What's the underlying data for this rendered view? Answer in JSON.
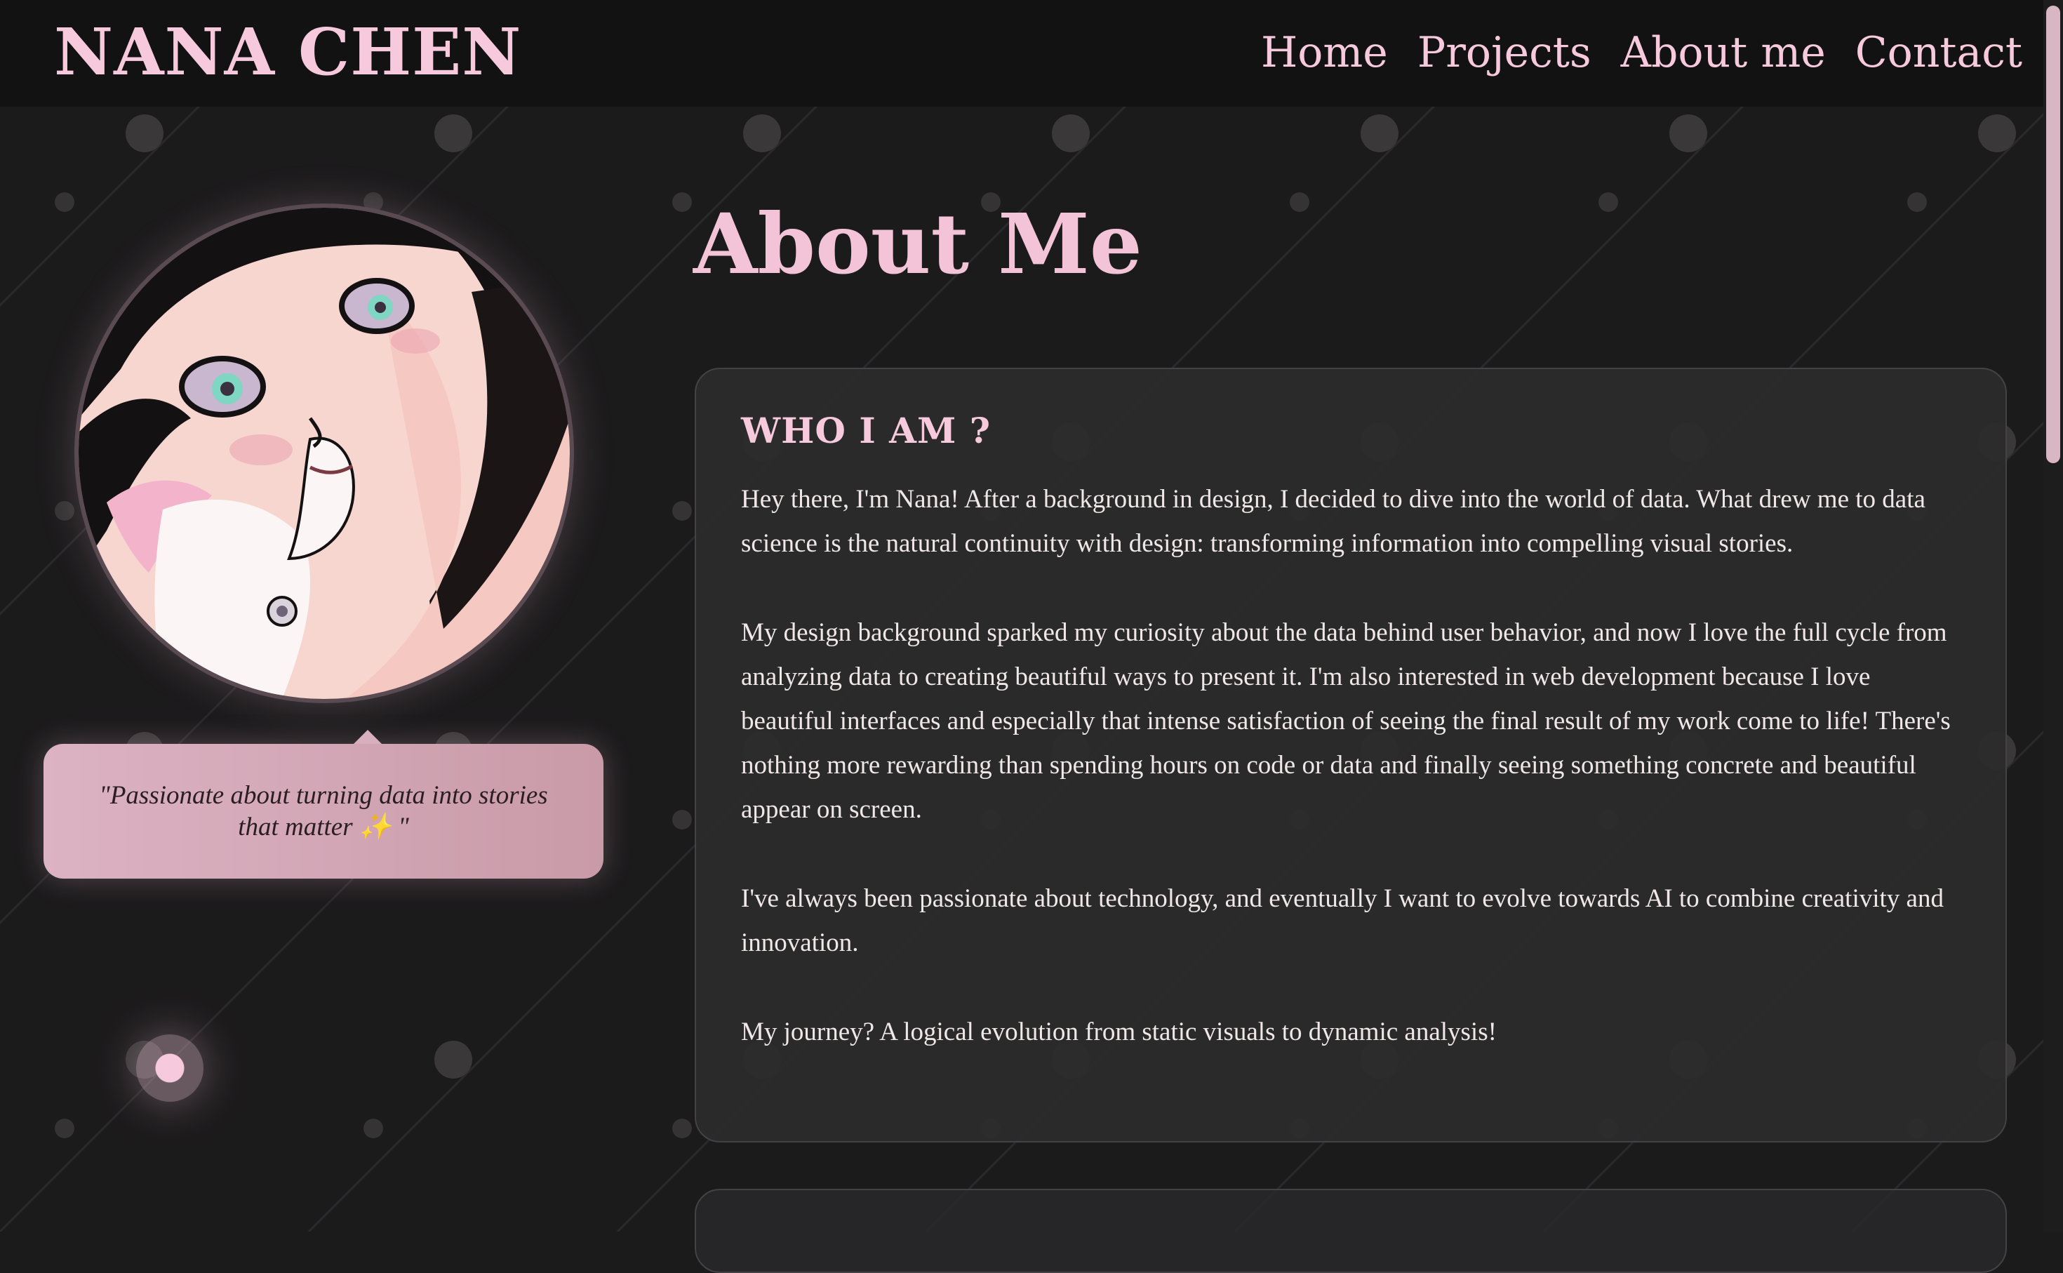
{
  "header": {
    "brand": "NANA CHEN",
    "nav": [
      "Home",
      "Projects",
      "About me",
      "Contact"
    ]
  },
  "profile": {
    "quote": "\"Passionate about turning data into stories that matter",
    "quote_end": "\"",
    "sparkle": "✨"
  },
  "main": {
    "title": "About Me",
    "card": {
      "heading": "WHO I AM ?",
      "paragraphs": [
        "Hey there, I'm Nana! After a background in design, I decided to dive into the world of data. What drew me to data science is the natural continuity with design: transforming information into compelling visual stories.",
        "My design background sparked my curiosity about the data behind user behavior, and now I love the full cycle from analyzing data to creating beautiful ways to present it. I'm also interested in web development because I love beautiful interfaces and especially that intense satisfaction of seeing the final result of my work come to life! There's nothing more rewarding than spending hours on code or data and finally seeing something concrete and beautiful appear on screen.",
        "I've always been passionate about technology, and eventually I want to evolve towards AI to combine creativity and innovation.",
        "My journey? A logical evolution from static visuals to dynamic analysis!"
      ]
    }
  },
  "colors": {
    "background": "#1c1b1c",
    "header": "#131213",
    "accent_pink": "#f6c9dc",
    "card": "#2c2b2d"
  },
  "icons": {
    "avatar": "anime-girl-portrait",
    "sparkle": "sparkles-emoji"
  }
}
